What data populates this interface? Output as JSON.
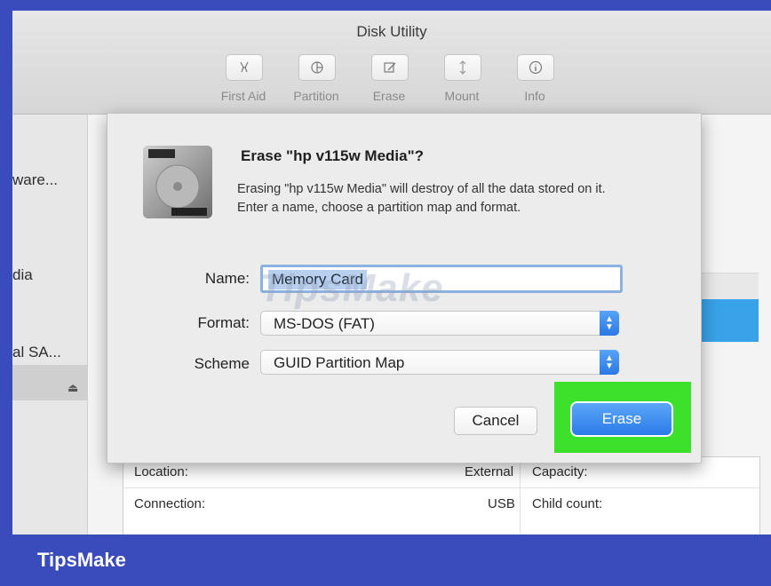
{
  "window": {
    "title": "Disk Utility"
  },
  "toolbar": {
    "buttons": [
      {
        "label": "First Aid",
        "icon": "first-aid-icon"
      },
      {
        "label": "Partition",
        "icon": "partition-icon"
      },
      {
        "label": "Erase",
        "icon": "erase-icon"
      },
      {
        "label": "Mount",
        "icon": "mount-icon"
      },
      {
        "label": "Info",
        "icon": "info-icon"
      }
    ]
  },
  "sidebar": {
    "items": [
      {
        "label": "ware..."
      },
      {
        "label": "dia"
      },
      {
        "label": "al SA..."
      }
    ],
    "eject": "⏏"
  },
  "info": {
    "location_label": "Location:",
    "location_value": "External",
    "capacity_label": "Capacity:",
    "connection_label": "Connection:",
    "connection_value": "USB",
    "child_count_label": "Child count:"
  },
  "dialog": {
    "title": "Erase \"hp v115w Media\"?",
    "message": "Erasing \"hp v115w Media\" will destroy of all the data stored on it. Enter a name, choose a partition map and format.",
    "name_label": "Name:",
    "name_value": "Memory Card",
    "format_label": "Format:",
    "format_value": "MS-DOS (FAT)",
    "scheme_label": "Scheme",
    "scheme_value": "GUID Partition Map",
    "cancel_label": "Cancel",
    "erase_label": "Erase"
  },
  "watermark": "TipsMake",
  "footer": {
    "brand": "TipsMake"
  },
  "colors": {
    "frame": "#3a4bbb",
    "highlight": "#3de02a",
    "accent": "#2b7be8"
  }
}
